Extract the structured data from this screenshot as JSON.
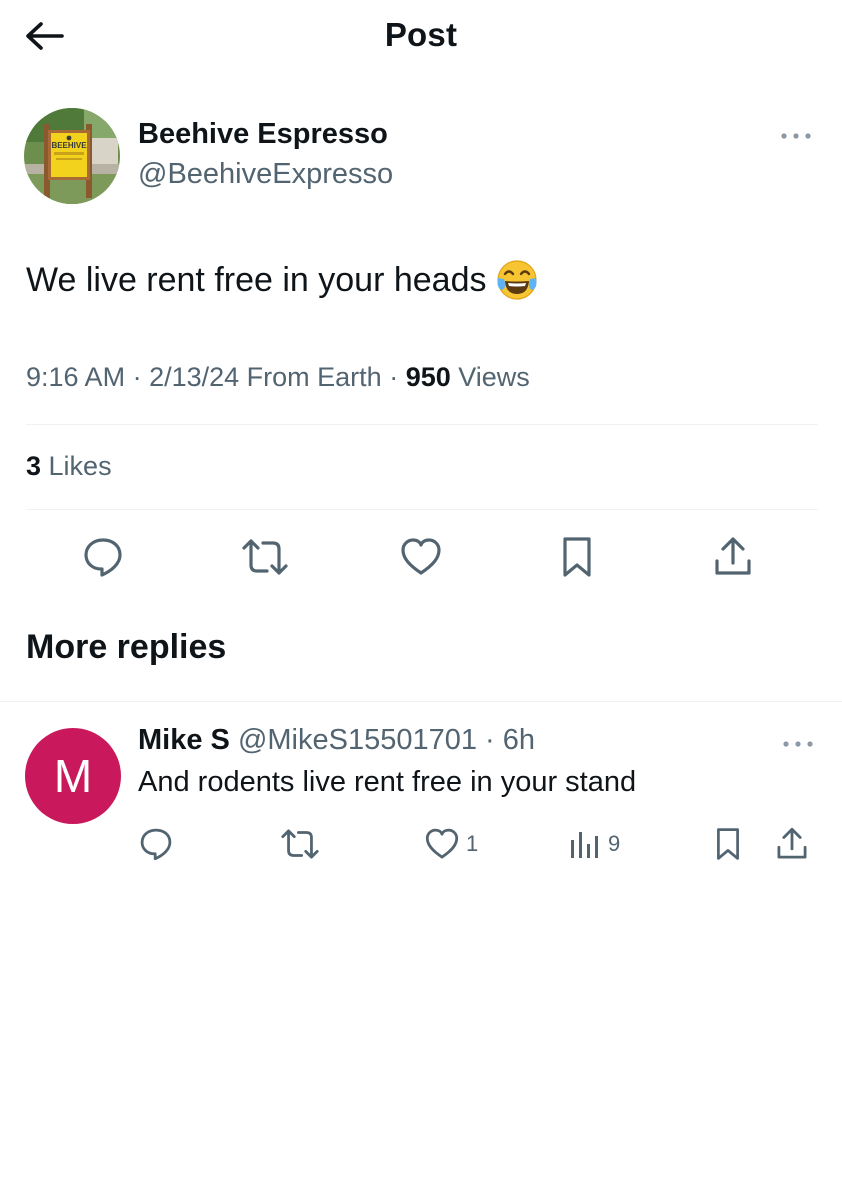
{
  "header": {
    "title": "Post"
  },
  "post": {
    "author": {
      "name": "Beehive Espresso",
      "handle": "@BeehiveExpresso",
      "avatar_sign_text": "BEEHIVE"
    },
    "text": "We live rent free in your heads",
    "emoji": "face-with-tears-of-joy",
    "meta": {
      "time": "9:16 AM",
      "sep1": " · ",
      "date": "2/13/24",
      "location": " From Earth",
      "sep2": " · ",
      "views_count": "950",
      "views_label": " Views"
    },
    "likes": {
      "count": "3",
      "label": " Likes"
    },
    "actions": [
      "reply-icon",
      "repost-icon",
      "like-icon",
      "bookmark-icon",
      "share-icon"
    ]
  },
  "replies_section": {
    "title": "More replies"
  },
  "reply": {
    "avatar_letter": "M",
    "avatar_color": "#c9185b",
    "name": "Mike S",
    "handle": "@MikeS15501701",
    "sep": " · ",
    "time": "6h",
    "text": "And rodents live rent free in your stand",
    "likes": "1",
    "views": "9"
  },
  "colors": {
    "text_primary": "#0f1419",
    "text_secondary": "#536471",
    "divider": "#eff3f4"
  }
}
